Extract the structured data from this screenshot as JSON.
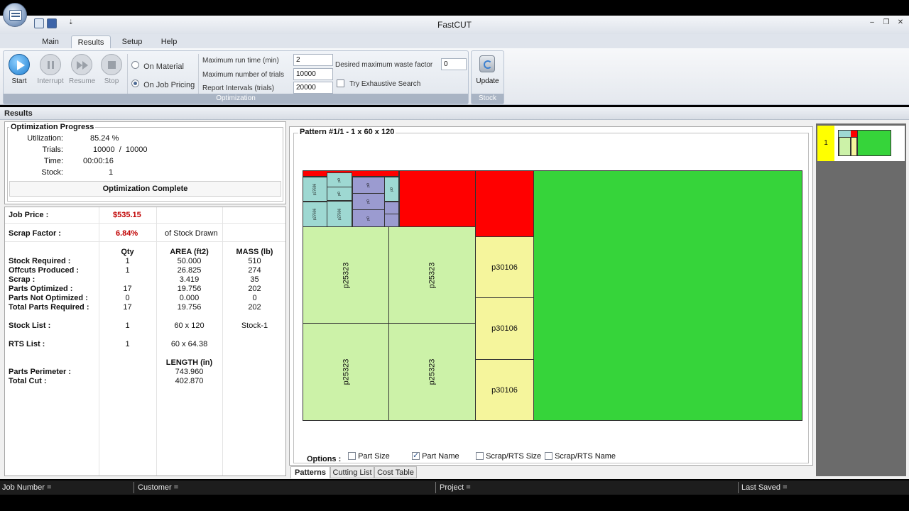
{
  "app": {
    "title": "FastCUT"
  },
  "tabs": [
    {
      "label": "Main"
    },
    {
      "label": "Results"
    },
    {
      "label": "Setup"
    },
    {
      "label": "Help"
    }
  ],
  "toolbar": {
    "start": "Start",
    "interrupt": "Interrupt",
    "resume": "Resume",
    "stop": "Stop",
    "on_material": "On Material",
    "on_job_pricing": "On Job Pricing",
    "max_run_time_label": "Maximum run time (min)",
    "max_run_time": "2",
    "max_trials_label": "Maximum number of trials",
    "max_trials": "10000",
    "report_intervals_label": "Report Intervals (trials)",
    "report_intervals": "20000",
    "waste_factor_label": "Desired maximum waste factor",
    "waste_factor": "0",
    "exhaustive_label": "Try Exhaustive Search",
    "optimization_group": "Optimization",
    "update": "Update",
    "stock_group": "Stock"
  },
  "results_header": "Results",
  "progress": {
    "title": "Optimization Progress",
    "utilization_label": "Utilization:",
    "utilization": "85.24 %",
    "trials_label": "Trials:",
    "trials": "10000  /  10000",
    "time_label": "Time:",
    "time": "00:00:16",
    "stock_label": "Stock:",
    "stock": "1",
    "status": "Optimization Complete"
  },
  "stats": {
    "job_price_label": "Job Price :",
    "job_price": "$535.15",
    "scrap_factor_label": "Scrap Factor :",
    "scrap_factor": "6.84%",
    "scrap_factor_note": "of Stock Drawn",
    "col_qty": "Qty",
    "col_area": "AREA (ft2)",
    "col_mass": "MASS (lb)",
    "rows": [
      {
        "label": "Stock Required :",
        "qty": "1",
        "area": "50.000",
        "mass": "510"
      },
      {
        "label": "Offcuts Produced :",
        "qty": "1",
        "area": "26.825",
        "mass": "274"
      },
      {
        "label": "Scrap :",
        "qty": "",
        "area": "3.419",
        "mass": "35"
      },
      {
        "label": "Parts Optimized :",
        "qty": "17",
        "area": "19.756",
        "mass": "202"
      },
      {
        "label": "Parts Not Optimized :",
        "qty": "0",
        "area": "0.000",
        "mass": "0"
      },
      {
        "label": "Total Parts Required :",
        "qty": "17",
        "area": "19.756",
        "mass": "202"
      }
    ],
    "stock_list_label": "Stock List :",
    "stock_list_qty": "1",
    "stock_list_size": "60 x 120",
    "stock_list_name": "Stock-1",
    "rts_list_label": "RTS List :",
    "rts_list_qty": "1",
    "rts_list_size": "60 x 64.38",
    "col_length": "LENGTH (in)",
    "perimeter_label": "Parts Perimeter :",
    "perimeter": "743.960",
    "total_cut_label": "Total Cut :",
    "total_cut": "402.870"
  },
  "pattern": {
    "title": "Pattern #1/1 - 1 x 60 x 120",
    "parts": {
      "p25323": "p25323",
      "p30106": "p30106",
      "p27636": "p27636",
      "small": "p0"
    },
    "colors": {
      "offcut": "#36d43a",
      "scrap": "#ff0000",
      "p25323": "#ccf2a8",
      "p30106": "#f5f59c",
      "p27636": "#9ed8d2",
      "purple": "#9b9bd0"
    }
  },
  "options": {
    "label": "Options :",
    "part_size": "Part Size",
    "part_size_checked": false,
    "part_name": "Part Name",
    "part_name_checked": true,
    "scrap_size": "Scrap/RTS Size",
    "scrap_size_checked": false,
    "scrap_name": "Scrap/RTS Name",
    "scrap_name_checked": false
  },
  "bottom_tabs": [
    {
      "label": "Patterns"
    },
    {
      "label": "Cutting List"
    },
    {
      "label": "Cost Table"
    }
  ],
  "thumbnails": [
    {
      "number": "1"
    }
  ],
  "statusbar": {
    "job_number": "Job Number =",
    "customer": "Customer =",
    "project": "Project =",
    "last_saved": "Last Saved ="
  }
}
